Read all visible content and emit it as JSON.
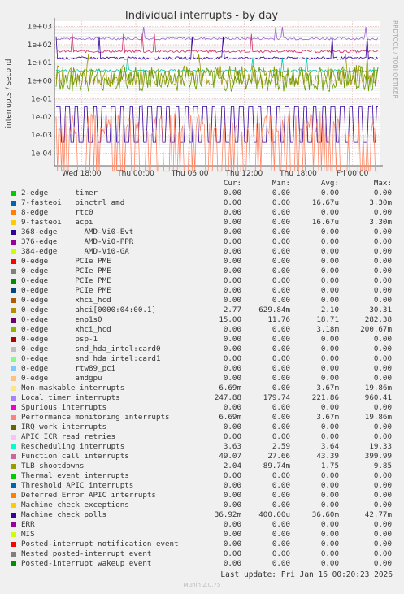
{
  "chart_data": {
    "type": "line",
    "title": "Individual interrupts - by day",
    "ylabel": "interrupts / second",
    "yscale": "log",
    "ylim": [
      2e-05,
      2000
    ],
    "yticks": [
      "1e+03",
      "1e+02",
      "1e+01",
      "1e+00",
      "1e-01",
      "1e-02",
      "1e-03",
      "1e-04"
    ],
    "xticks": [
      "Wed 18:00",
      "Thu 00:00",
      "Thu 06:00",
      "Thu 12:00",
      "Thu 18:00",
      "Fri 00:00"
    ],
    "side_label": "RRDTOOL / TOBI OETIKER",
    "grid": true,
    "series_shown": [
      {
        "name": "Local timer interrupts",
        "color": "#9966cc",
        "base": 220,
        "min": 180,
        "max": 960
      },
      {
        "name": "Function call interrupts",
        "color": "#cc3366",
        "base": 43,
        "min": 28,
        "max": 400
      },
      {
        "name": "enp1s0",
        "color": "#330099",
        "base": 18,
        "min": 11.8,
        "max": 282
      },
      {
        "name": "Rescheduling interrupts",
        "color": "#00ccaa",
        "base": 3.6,
        "min": 2.6,
        "max": 19.3
      },
      {
        "name": "ahci[0000:04:00.1]",
        "color": "#999900",
        "base": 2.1,
        "min": 0.6,
        "max": 30
      },
      {
        "name": "TLB shootdowns",
        "color": "#669900",
        "base": 1.75,
        "min": 0.09,
        "max": 9.85
      },
      {
        "name": "Machine check polls",
        "color": "#330099",
        "base": 0.0366,
        "min": 0.0004,
        "max": 0.0428
      },
      {
        "name": "Performance monitoring interrupts",
        "color": "#ff8866",
        "base": 0.004,
        "min": 1e-05,
        "max": 0.02
      }
    ]
  },
  "legend": {
    "headers": [
      "Cur:",
      "Min:",
      "Avg:",
      "Max:"
    ],
    "rows": [
      {
        "name": "2-edge      timer",
        "color": "#00cc00",
        "cur": "0.00",
        "min": "0.00",
        "avg": "0.00",
        "max": "0.00"
      },
      {
        "name": "7-fasteoi   pinctrl_amd",
        "color": "#0066b3",
        "cur": "0.00",
        "min": "0.00",
        "avg": "16.67u",
        "max": "3.30m"
      },
      {
        "name": "8-edge      rtc0",
        "color": "#ff8000",
        "cur": "0.00",
        "min": "0.00",
        "avg": "0.00",
        "max": "0.00"
      },
      {
        "name": "9-fasteoi   acpi",
        "color": "#ffcc00",
        "cur": "0.00",
        "min": "0.00",
        "avg": "16.67u",
        "max": "3.30m"
      },
      {
        "name": "368-edge      AMD-Vi0-Evt",
        "color": "#330099",
        "cur": "0.00",
        "min": "0.00",
        "avg": "0.00",
        "max": "0.00"
      },
      {
        "name": "376-edge      AMD-Vi0-PPR",
        "color": "#990099",
        "cur": "0.00",
        "min": "0.00",
        "avg": "0.00",
        "max": "0.00"
      },
      {
        "name": "384-edge      AMD-Vi0-GA",
        "color": "#ccff00",
        "cur": "0.00",
        "min": "0.00",
        "avg": "0.00",
        "max": "0.00"
      },
      {
        "name": "0-edge      PCIe PME",
        "color": "#ff0000",
        "cur": "0.00",
        "min": "0.00",
        "avg": "0.00",
        "max": "0.00"
      },
      {
        "name": "0-edge      PCIe PME",
        "color": "#808080",
        "cur": "0.00",
        "min": "0.00",
        "avg": "0.00",
        "max": "0.00"
      },
      {
        "name": "0-edge      PCIe PME",
        "color": "#008f00",
        "cur": "0.00",
        "min": "0.00",
        "avg": "0.00",
        "max": "0.00"
      },
      {
        "name": "0-edge      PCIe PME",
        "color": "#00487d",
        "cur": "0.00",
        "min": "0.00",
        "avg": "0.00",
        "max": "0.00"
      },
      {
        "name": "0-edge      xhci_hcd",
        "color": "#b35a00",
        "cur": "0.00",
        "min": "0.00",
        "avg": "0.00",
        "max": "0.00"
      },
      {
        "name": "0-edge      ahci[0000:04:00.1]",
        "color": "#b38f00",
        "cur": "2.77",
        "min": "629.84m",
        "avg": "2.10",
        "max": "30.31"
      },
      {
        "name": "0-edge      enp1s0",
        "color": "#6b006b",
        "cur": "15.00",
        "min": "11.76",
        "avg": "18.71",
        "max": "282.38"
      },
      {
        "name": "0-edge      xhci_hcd",
        "color": "#8fb300",
        "cur": "0.00",
        "min": "0.00",
        "avg": "3.18m",
        "max": "200.67m"
      },
      {
        "name": "0-edge      psp-1",
        "color": "#b30000",
        "cur": "0.00",
        "min": "0.00",
        "avg": "0.00",
        "max": "0.00"
      },
      {
        "name": "0-edge      snd_hda_intel:card0",
        "color": "#bebebe",
        "cur": "0.00",
        "min": "0.00",
        "avg": "0.00",
        "max": "0.00"
      },
      {
        "name": "0-edge      snd_hda_intel:card1",
        "color": "#80ff80",
        "cur": "0.00",
        "min": "0.00",
        "avg": "0.00",
        "max": "0.00"
      },
      {
        "name": "0-edge      rtw89_pci",
        "color": "#80c9ff",
        "cur": "0.00",
        "min": "0.00",
        "avg": "0.00",
        "max": "0.00"
      },
      {
        "name": "0-edge      amdgpu",
        "color": "#ffc080",
        "cur": "0.00",
        "min": "0.00",
        "avg": "0.00",
        "max": "0.00"
      },
      {
        "name": "Non-maskable interrupts",
        "color": "#ffe680",
        "cur": "6.69m",
        "min": "0.00",
        "avg": "3.67m",
        "max": "19.86m"
      },
      {
        "name": "Local timer interrupts",
        "color": "#aa80ff",
        "cur": "247.88",
        "min": "179.74",
        "avg": "221.86",
        "max": "960.41"
      },
      {
        "name": "Spurious interrupts",
        "color": "#ee00cc",
        "cur": "0.00",
        "min": "0.00",
        "avg": "0.00",
        "max": "0.00"
      },
      {
        "name": "Performance monitoring interrupts",
        "color": "#ff8080",
        "cur": "6.69m",
        "min": "0.00",
        "avg": "3.67m",
        "max": "19.86m"
      },
      {
        "name": "IRQ work interrupts",
        "color": "#666600",
        "cur": "0.00",
        "min": "0.00",
        "avg": "0.00",
        "max": "0.00"
      },
      {
        "name": "APIC ICR read retries",
        "color": "#ffbfff",
        "cur": "0.00",
        "min": "0.00",
        "avg": "0.00",
        "max": "0.00"
      },
      {
        "name": "Rescheduling interrupts",
        "color": "#00ffcc",
        "cur": "3.63",
        "min": "2.59",
        "avg": "3.64",
        "max": "19.33"
      },
      {
        "name": "Function call interrupts",
        "color": "#cc6699",
        "cur": "49.07",
        "min": "27.66",
        "avg": "43.39",
        "max": "399.99"
      },
      {
        "name": "TLB shootdowns",
        "color": "#999900",
        "cur": "2.04",
        "min": "89.74m",
        "avg": "1.75",
        "max": "9.85"
      },
      {
        "name": "Thermal event interrupts",
        "color": "#00cc00",
        "cur": "0.00",
        "min": "0.00",
        "avg": "0.00",
        "max": "0.00"
      },
      {
        "name": "Threshold APIC interrupts",
        "color": "#0066b3",
        "cur": "0.00",
        "min": "0.00",
        "avg": "0.00",
        "max": "0.00"
      },
      {
        "name": "Deferred Error APIC interrupts",
        "color": "#ff8000",
        "cur": "0.00",
        "min": "0.00",
        "avg": "0.00",
        "max": "0.00"
      },
      {
        "name": "Machine check exceptions",
        "color": "#ffcc00",
        "cur": "0.00",
        "min": "0.00",
        "avg": "0.00",
        "max": "0.00"
      },
      {
        "name": "Machine check polls",
        "color": "#330099",
        "cur": "36.92m",
        "min": "400.00u",
        "avg": "36.60m",
        "max": "42.77m"
      },
      {
        "name": "ERR",
        "color": "#990099",
        "cur": "0.00",
        "min": "0.00",
        "avg": "0.00",
        "max": "0.00"
      },
      {
        "name": "MIS",
        "color": "#ccff00",
        "cur": "0.00",
        "min": "0.00",
        "avg": "0.00",
        "max": "0.00"
      },
      {
        "name": "Posted-interrupt notification event",
        "color": "#ff0000",
        "cur": "0.00",
        "min": "0.00",
        "avg": "0.00",
        "max": "0.00"
      },
      {
        "name": "Nested posted-interrupt event",
        "color": "#808080",
        "cur": "0.00",
        "min": "0.00",
        "avg": "0.00",
        "max": "0.00"
      },
      {
        "name": "Posted-interrupt wakeup event",
        "color": "#008f00",
        "cur": "0.00",
        "min": "0.00",
        "avg": "0.00",
        "max": "0.00"
      }
    ]
  },
  "footer": {
    "last_update": "Last update: Fri Jan 16 00:20:23 2026",
    "munin": "Munin 2.0.75"
  }
}
